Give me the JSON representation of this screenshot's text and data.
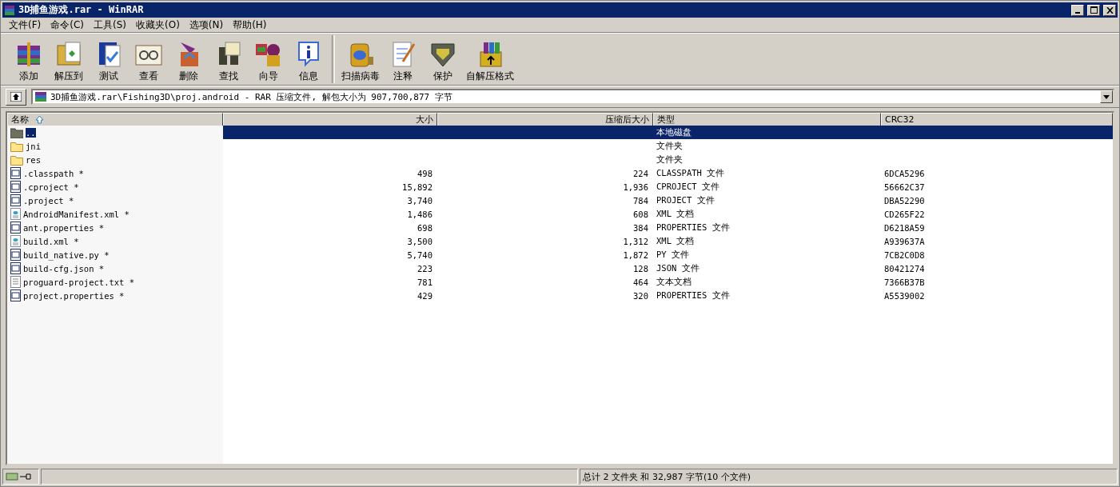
{
  "window": {
    "title": "3D捕鱼游戏.rar - WinRAR"
  },
  "menu": [
    "文件(F)",
    "命令(C)",
    "工具(S)",
    "收藏夹(O)",
    "选项(N)",
    "帮助(H)"
  ],
  "toolbar": [
    {
      "label": "添加"
    },
    {
      "label": "解压到"
    },
    {
      "label": "测试"
    },
    {
      "label": "查看"
    },
    {
      "label": "删除"
    },
    {
      "label": "查找"
    },
    {
      "label": "向导"
    },
    {
      "label": "信息"
    },
    {
      "label": "扫描病毒"
    },
    {
      "label": "注释"
    },
    {
      "label": "保护"
    },
    {
      "label": "自解压格式"
    }
  ],
  "address": {
    "value": "3D捕鱼游戏.rar\\Fishing3D\\proj.android - RAR 压缩文件, 解包大小为 907,700,877 字节"
  },
  "table": {
    "columns": [
      "名称",
      "大小",
      "压缩后大小",
      "类型",
      "CRC32"
    ],
    "rows": [
      {
        "kind": "parent",
        "name": "..",
        "size": "",
        "packed": "",
        "type": "本地磁盘",
        "crc": "",
        "selected": true
      },
      {
        "kind": "folder",
        "name": "jni",
        "size": "",
        "packed": "",
        "type": "文件夹",
        "crc": "",
        "selected": false
      },
      {
        "kind": "folder",
        "name": "res",
        "size": "",
        "packed": "",
        "type": "文件夹",
        "crc": "",
        "selected": false
      },
      {
        "kind": "file",
        "name": ".classpath *",
        "size": "498",
        "packed": "224",
        "type": "CLASSPATH 文件",
        "crc": "6DCA5296",
        "selected": false
      },
      {
        "kind": "file",
        "name": ".cproject *",
        "size": "15,892",
        "packed": "1,936",
        "type": "CPROJECT 文件",
        "crc": "56662C37",
        "selected": false
      },
      {
        "kind": "file",
        "name": ".project *",
        "size": "3,740",
        "packed": "784",
        "type": "PROJECT 文件",
        "crc": "DBA52290",
        "selected": false
      },
      {
        "kind": "xml",
        "name": "AndroidManifest.xml *",
        "size": "1,486",
        "packed": "608",
        "type": "XML 文档",
        "crc": "CD265F22",
        "selected": false
      },
      {
        "kind": "file",
        "name": "ant.properties *",
        "size": "698",
        "packed": "384",
        "type": "PROPERTIES 文件",
        "crc": "D6218A59",
        "selected": false
      },
      {
        "kind": "xml",
        "name": "build.xml *",
        "size": "3,500",
        "packed": "1,312",
        "type": "XML 文档",
        "crc": "A939637A",
        "selected": false
      },
      {
        "kind": "file",
        "name": "build_native.py *",
        "size": "5,740",
        "packed": "1,872",
        "type": "PY 文件",
        "crc": "7CB2C0D8",
        "selected": false
      },
      {
        "kind": "file",
        "name": "build-cfg.json *",
        "size": "223",
        "packed": "128",
        "type": "JSON 文件",
        "crc": "80421274",
        "selected": false
      },
      {
        "kind": "text",
        "name": "proguard-project.txt *",
        "size": "781",
        "packed": "464",
        "type": "文本文档",
        "crc": "7366B37B",
        "selected": false
      },
      {
        "kind": "file",
        "name": "project.properties *",
        "size": "429",
        "packed": "320",
        "type": "PROPERTIES 文件",
        "crc": "A5539002",
        "selected": false
      }
    ]
  },
  "status_bar": {
    "summary": "总计 2 文件夹 和 32,987 字节(10 个文件)"
  }
}
